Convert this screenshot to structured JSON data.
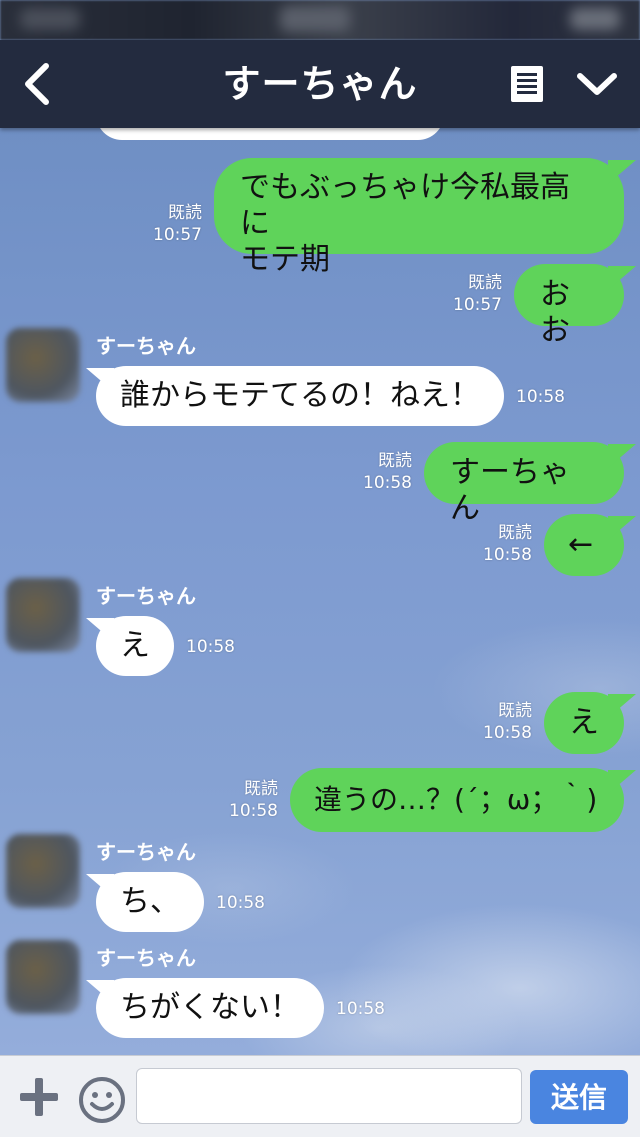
{
  "header": {
    "title": "すーちゃん",
    "back_icon": "chevron-left-icon",
    "menu_icon": "list-icon",
    "expand_icon": "chevron-down-icon"
  },
  "messages": [
    {
      "from": "me",
      "text1": "でもぶっちゃけ今私最高に",
      "text2": "モテ期",
      "read": "既読",
      "time": "10:57"
    },
    {
      "from": "me",
      "text": "おお",
      "read": "既読",
      "time": "10:57"
    },
    {
      "from": "them",
      "sender": "すーちゃん",
      "text": "誰からモテてるの！ねえ！",
      "time": "10:58"
    },
    {
      "from": "me",
      "text": "すーちゃん",
      "read": "既読",
      "time": "10:58"
    },
    {
      "from": "me",
      "text": "←",
      "read": "既読",
      "time": "10:58"
    },
    {
      "from": "them",
      "sender": "すーちゃん",
      "text": "え",
      "time": "10:58"
    },
    {
      "from": "me",
      "text": "え",
      "read": "既読",
      "time": "10:58"
    },
    {
      "from": "me",
      "text": "違うの…？(´；ω；｀)",
      "read": "既読",
      "time": "10:58"
    },
    {
      "from": "them",
      "sender": "すーちゃん",
      "text": "ち、",
      "time": "10:58"
    },
    {
      "from": "them",
      "sender": "すーちゃん",
      "text": "ちがくない！",
      "time": "10:58"
    }
  ],
  "input": {
    "placeholder": "",
    "send_label": "送信",
    "plus_icon": "plus-icon",
    "emoji_icon": "smiley-icon"
  },
  "colors": {
    "header": "#232b3f",
    "my_bubble": "#5fd35a",
    "their_bubble": "#ffffff",
    "send_button": "#4a85e0"
  }
}
